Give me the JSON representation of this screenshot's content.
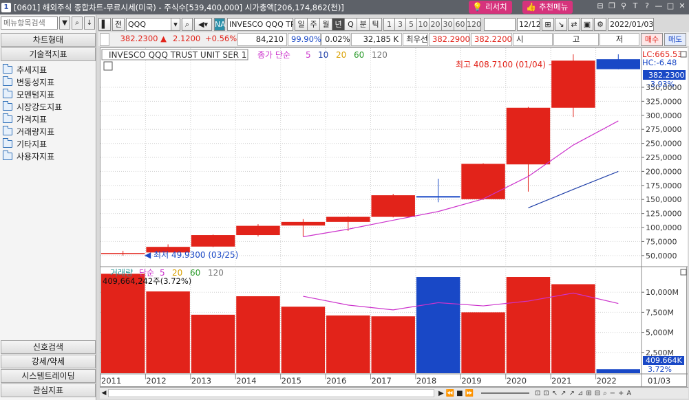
{
  "window": {
    "num": "1",
    "title": "[0601] 해외주식 종합차트-무료시세(미국) - 주식수[539,400,000] 시가총액[206,174,862(천)]",
    "btn_research": "리서치",
    "btn_menu": "추천메뉴",
    "controls": [
      "⊟",
      "❐",
      "📌",
      "T",
      "?",
      "—",
      "❐",
      "✕"
    ]
  },
  "sidebar": {
    "search_placeholder": "메뉴항목검색",
    "tab_chart": "차트형태",
    "tab_tech": "기술적지표",
    "items": [
      "추세지표",
      "변동성지표",
      "모멘텀지표",
      "시장강도지표",
      "가격지표",
      "거래량지표",
      "기타지표",
      "사용자지표"
    ],
    "bottom": [
      "신호검색",
      "강세/약세",
      "시스템트레이딩",
      "관심지표"
    ]
  },
  "toolbar": {
    "mode": "전",
    "symbol": "QQQ",
    "na": "NA",
    "name": "INVESCO QQQ TRUS",
    "periods": [
      "일",
      "주",
      "월",
      "년",
      "Q",
      "분",
      "틱"
    ],
    "active_period": "년",
    "nums": [
      "1",
      "3",
      "5",
      "10",
      "20",
      "30",
      "60",
      "120"
    ],
    "count": "12/12",
    "date": "2022/01/03"
  },
  "quote": {
    "price": "382.2300",
    "arrow": "▲",
    "change": "2.1200",
    "pct": "+0.56%",
    "volume": "84,210",
    "ratio": "99.90%",
    "rate2": "0.02%",
    "amount": "32,185 K",
    "best_label": "최우선",
    "ask": "382.2900",
    "bid": "382.2200",
    "ohl": [
      "시",
      "고",
      "저"
    ],
    "buy": "매수",
    "sell": "매도"
  },
  "price_panel": {
    "legend_name": "INVESCO QQQ TRUST UNIT SER 1",
    "legend_ma": "종가 단순",
    "ma_periods": [
      "5",
      "10",
      "20",
      "60",
      "120"
    ],
    "ma_colors": [
      "#cc33cc",
      "#1f3fa8",
      "#d9a000",
      "#2a9a2a",
      "#777777"
    ],
    "lc": "LC:665.53",
    "hc": "HC:-6.48",
    "price_tag": "382.2300",
    "pct_tag": "-3.93%",
    "high_note": "최고 408.7100 (01/04) →",
    "low_note": "◀ 최저 49.9300 (03/25)",
    "y_ticks": [
      "350,0000",
      "325,0000",
      "300,0000",
      "275,0000",
      "250,0000",
      "225,0000",
      "200,0000",
      "175,0000",
      "150,0000",
      "125,0000",
      "100,0000",
      "75,0000",
      "50,0000"
    ]
  },
  "volume_panel": {
    "legend_name": "거래량",
    "legend_ma": "단순",
    "ma_periods": [
      "5",
      "20",
      "60",
      "120"
    ],
    "last_value": "409,664,242주(3.72%)",
    "y_ticks": [
      "10,000M",
      "7,500M",
      "5,000M",
      "2,500M"
    ],
    "tag_value": "409.664K",
    "tag_pct": "3.72%"
  },
  "x_axis": [
    "2011",
    "2012",
    "2013",
    "2014",
    "2015",
    "2016",
    "2017",
    "2018",
    "2019",
    "2020",
    "2021",
    "2022"
  ],
  "x_axis_end": "01/03",
  "colors": {
    "up": "#e2231a",
    "down": "#1948c6",
    "ma5": "#cc33cc",
    "ma10": "#1f3fa8"
  },
  "chart_data": {
    "type": "candlestick",
    "categories": [
      "2011",
      "2012",
      "2013",
      "2014",
      "2015",
      "2016",
      "2017",
      "2018",
      "2019",
      "2020",
      "2021",
      "2022"
    ],
    "open": [
      54.5,
      55.5,
      66.0,
      86.5,
      103.5,
      110.0,
      119.0,
      156.0,
      150.5,
      212.5,
      313.5,
      400.0
    ],
    "close": [
      54.5,
      65.5,
      86.5,
      103.0,
      110.0,
      119.0,
      157.5,
      153.5,
      213.5,
      313.5,
      397.5,
      382.2
    ],
    "high": [
      58.5,
      70.0,
      87.5,
      106.0,
      115.0,
      120.0,
      160.0,
      187.0,
      214.5,
      315.0,
      408.7,
      408.7
    ],
    "low": [
      49.93,
      57.0,
      65.0,
      84.0,
      84.0,
      94.0,
      118.0,
      145.0,
      149.0,
      164.0,
      297.0,
      382.0
    ],
    "ma5": [
      null,
      null,
      null,
      null,
      83.5,
      97.0,
      113.0,
      128.5,
      151.0,
      191.0,
      247.0,
      290.0
    ],
    "ma10": [
      null,
      null,
      null,
      null,
      null,
      null,
      null,
      null,
      null,
      135.0,
      168.0,
      200.0
    ],
    "volume_M": [
      12300,
      10100,
      7200,
      9500,
      8200,
      7100,
      7000,
      11900,
      7500,
      11900,
      11000,
      410
    ],
    "volume_ma5": [
      null,
      null,
      null,
      null,
      9500,
      8400,
      7800,
      8700,
      8300,
      8900,
      9900,
      8600
    ],
    "ylim_price": [
      40,
      410
    ],
    "ylim_volume": [
      0,
      12500
    ]
  }
}
